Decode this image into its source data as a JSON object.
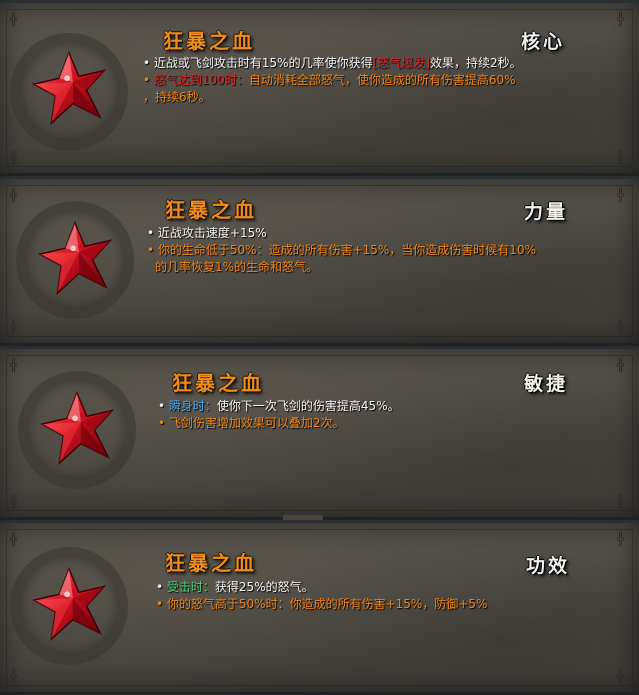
{
  "panels": [
    {
      "title": "狂暴之血",
      "category": "核心",
      "line1": {
        "bullet": "•",
        "text_a": "近战或飞剑攻击时有15%的几率使你获得",
        "keyword": "[怒气爆发]",
        "text_b": "效果，持续2秒。"
      },
      "line2": {
        "bullet": "•",
        "condition": "怒气达到100时：",
        "effect": "自动消耗全部怒气，使你造成的所有伤害提高60%"
      },
      "line3": "，持续6秒。"
    },
    {
      "title": "狂暴之血",
      "category": "力量",
      "line1": {
        "bullet": "•",
        "text": "近战攻击速度+15%"
      },
      "line2": {
        "bullet": "•",
        "text": "你的生命低于50%：造成的所有伤害+15%，当你造成伤害时候有10%"
      },
      "line3": "的几率恢复1%的生命和怒气。"
    },
    {
      "title": "狂暴之血",
      "category": "敏捷",
      "line1": {
        "bullet": "•",
        "condition": "瞬身时：",
        "text": "使你下一次飞剑的伤害提高45%。"
      },
      "line2": {
        "bullet": "•",
        "text": "飞剑伤害增加效果可以叠加2次。"
      }
    },
    {
      "title": "狂暴之血",
      "category": "功效",
      "line1": {
        "bullet": "•",
        "condition": "受击时：",
        "text": "获得25%的怒气。"
      },
      "line2": {
        "bullet": "•",
        "text": "你的怒气高于50%时：你造成的所有伤害+15%，防御+5%"
      }
    }
  ],
  "icons": {
    "gem": "blood-crystal-icon",
    "corner": "rune-corner-icon"
  },
  "colors": {
    "title": "#f08c1c",
    "category": "#f3f0ea",
    "orange_text": "#f08418",
    "keyword_red": "#e0262a",
    "blue_condition": "#4aa6e6",
    "green_condition": "#49cf7a",
    "gem_red": "#d01020"
  }
}
